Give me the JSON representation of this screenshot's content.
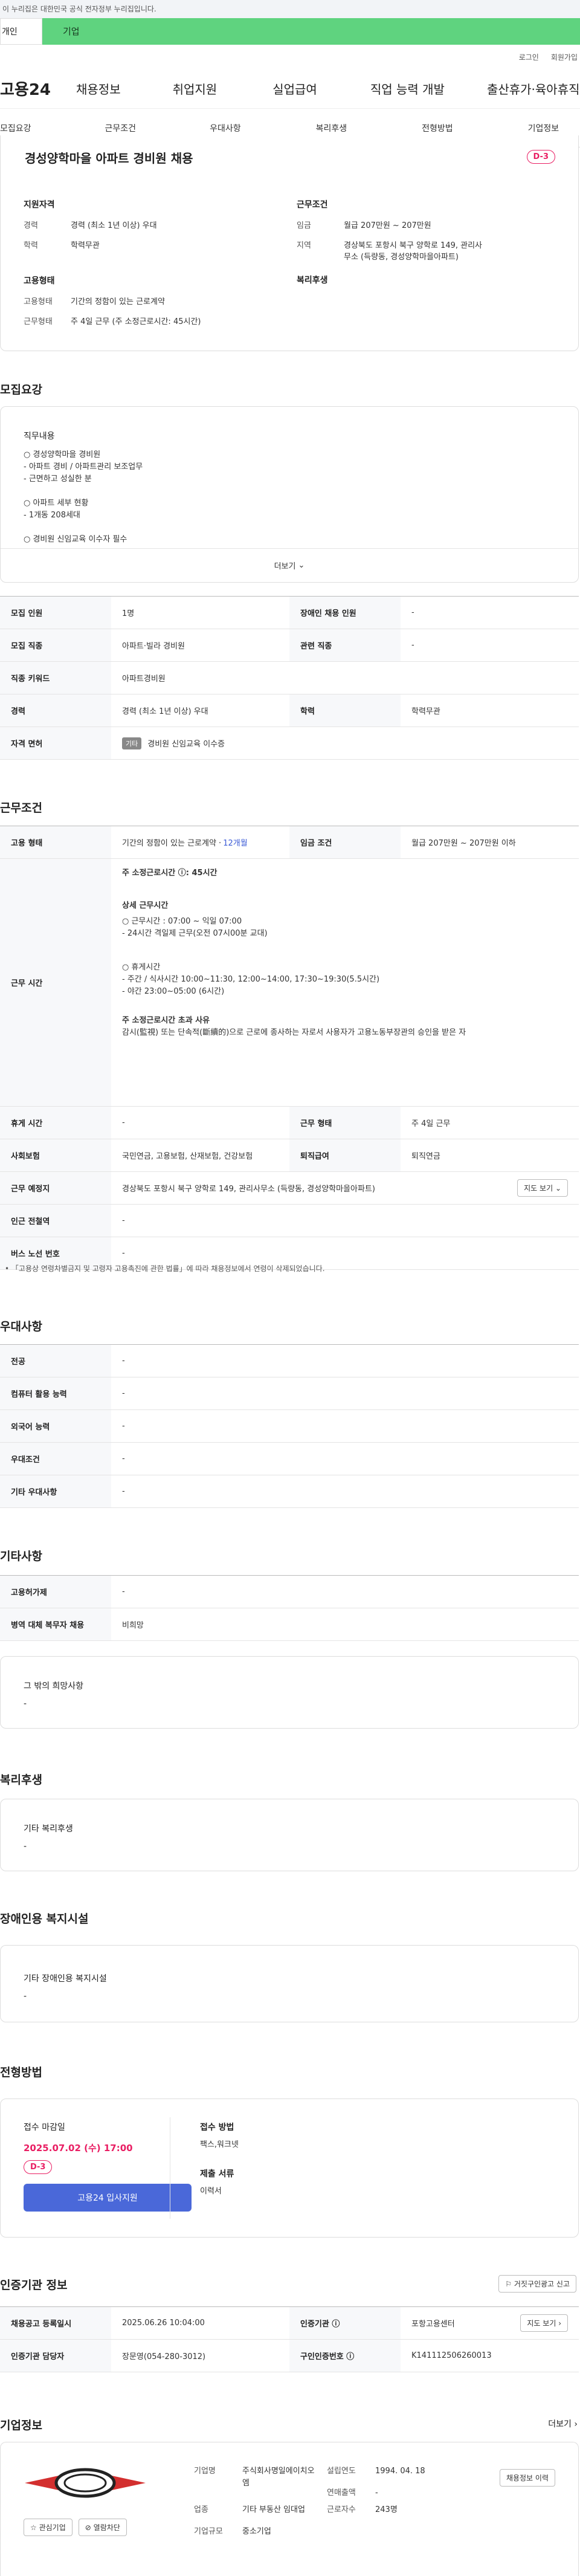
{
  "gov_banner": "이 누리집은 대한민국 공식 전자정부 누리집입니다.",
  "top_tabs": {
    "left": "개인",
    "right": "기업"
  },
  "util": {
    "login": "로그인",
    "join": "회원가입"
  },
  "gnb": {
    "logo": "고용24",
    "menus": [
      "채용정보",
      "취업지원",
      "실업급여",
      "직업 능력 개발",
      "출산휴가·육아휴직"
    ]
  },
  "subnav": [
    "모집요강",
    "근무조건",
    "우대사항",
    "복리후생",
    "전형방법",
    "기업정보"
  ],
  "summary": {
    "title": "경성양학마을 아파트 경비원 채용",
    "dday": "D-3",
    "qual_title": "지원자격",
    "career_k": "경력",
    "career_v": "경력 (최소 1년 이상) 우대",
    "edu_k": "학력",
    "edu_v": "학력무관",
    "cond_title": "근무조건",
    "wage_k": "임금",
    "wage_v": "월급 207만원 ~ 207만원",
    "region_k": "지역",
    "region_v": "경상북도 포항시 북구 양학로 149, 관리사무소 (득량동, 경성양학마을아파트)",
    "emp_title": "고용형태",
    "emptype_k": "고용형태",
    "emptype_v": "기간의 정함이 있는 근로계약",
    "worktype_k": "근무형태",
    "worktype_v": "주 4일 근무 (주 소정근로시간: 45시간)",
    "welfare_title": "복리후생"
  },
  "recruit": {
    "section": "모집요강",
    "duty_title": "직무내용",
    "duty_lines": [
      "○ 경성양학마을 경비원",
      "- 아파트 경비 / 아파트관리 보조업무",
      "- 근면하고 성실한 분",
      "○ 아파트 세부 현황",
      "- 1개동 208세대",
      "○ 경비원 신임교육 이수자 필수"
    ],
    "more": "더보기",
    "rows": [
      [
        "모집 인원",
        "1명",
        "장애인 채용 인원",
        "-"
      ],
      [
        "모집 직종",
        "아파트·빌라 경비원",
        "관련 직종",
        "-"
      ]
    ],
    "keyword_k": "직종 키워드",
    "keyword_v": "아파트경비원",
    "career_k": "경력",
    "career_v": "경력 (최소 1년 이상) 우대",
    "edu_k": "학력",
    "edu_v": "학력무관",
    "license_k": "자격 면허",
    "license_tag": "기타",
    "license_v": "경비원 신임교육 이수증"
  },
  "conditions": {
    "section": "근무조건",
    "emp_k": "고용 형태",
    "emp_v": "기간의 정함이 있는 근로계약 · ",
    "emp_months": "12개월",
    "wage_k": "임금 조건",
    "wage_v": "월급 207만원 ~ 207만원 이하",
    "time_k": "근무 시간",
    "time_lines": [
      "주 소정근로시간 ⓘ: 45시간",
      "상세 근무시간",
      "○ 근무시간 : 07:00 ~ 익일 07:00",
      "- 24시간 격일제 근무(오전 07시00분 교대)",
      "○ 휴게시간",
      "- 주간 / 식사시간 10:00~11:30, 12:00~14:00, 17:30~19:30(5.5시간)",
      "- 야간 23:00~05:00 (6시간)",
      "주 소정근로시간 초과 사유",
      "감시(監視) 또는 단속적(斷續的)으로 근로에 종사하는 자로서 사용자가 고용노동부장관의 승인을 받은 자"
    ],
    "rest_k": "휴게 시간",
    "rest_v": "-",
    "form_k": "근무 형태",
    "form_v": "주 4일 근무",
    "ins_k": "사회보험",
    "ins_v": "국민연금, 고용보험, 산재보험, 건강보험",
    "ret_k": "퇴직급여",
    "ret_v": "퇴직연금",
    "place_k": "근무 예정지",
    "place_v": "경상북도 포항시 북구 양학로 149, 관리사무소 (득량동, 경성양학마을아파트)",
    "map_btn": "지도 보기",
    "station_k": "인근 전철역",
    "station_v": "-",
    "bus_k": "버스 노선 번호",
    "bus_v": "-",
    "notice": "「고용상 연령차별금지 및 고령자 고용촉진에 관한 법률」에 따라 채용정보에서 연령이 삭제되었습니다."
  },
  "pref": {
    "section": "우대사항",
    "rows": [
      [
        "전공",
        "-"
      ],
      [
        "컴퓨터 활용 능력",
        "-"
      ],
      [
        "외국어 능력",
        "-"
      ],
      [
        "우대조건",
        "-"
      ],
      [
        "기타 우대사항",
        "-"
      ]
    ]
  },
  "etc": {
    "section": "기타사항",
    "rows": [
      [
        "고용허가제",
        "-"
      ],
      [
        "병역 대체 복무자 채용",
        "비희망"
      ]
    ],
    "hope_title": "그 밖의 희망사항",
    "hope_v": "-"
  },
  "welfare": {
    "section": "복리후생",
    "box_title": "기타 복리후생",
    "box_v": "-"
  },
  "disab": {
    "section": "장애인용 복지시설",
    "box_title": "기타 장애인용 복지시설",
    "box_v": "-"
  },
  "process": {
    "section": "전형방법",
    "deadline_k": "접수 마감일",
    "deadline_v": "2025.07.02 (수) 17:00",
    "dday": "D-3",
    "apply_btn": "고용24 입사지원",
    "method_k": "접수 방법",
    "method_v": "팩스,워크넷",
    "docs_k": "제출 서류",
    "docs_v": "이력서"
  },
  "cert": {
    "section": "인증기관 정보",
    "report_btn": "거짓구인광고 신고",
    "reg_k": "채용공고 등록일시",
    "reg_v": "2025.06.26 10:04:00",
    "org_k": "인증기관 ⓘ",
    "org_v": "포항고용센터",
    "map_btn": "지도 보기",
    "mgr_k": "인증기관 담당자",
    "mgr_v": "장문영(054-280-3012)",
    "num_k": "구인인증번호 ⓘ",
    "num_v": "K141112506260013"
  },
  "company": {
    "section": "기업정보",
    "more": "더보기",
    "industry_k": "기업명",
    "industry_v": "주식회사명일에이치오엠",
    "year_k": "설립연도",
    "year_v": "1994. 04. 18",
    "history_btn": "채용정보 이력",
    "sales_k": "연매출액",
    "sales_v": "-",
    "biz_k": "업종",
    "biz_v": "기타 부동산 임대업",
    "emp_k": "근로자수",
    "emp_v": "243명",
    "size_k": "기업규모",
    "size_v": "중소기업",
    "fav_btn": "관심기업",
    "block_btn": "열람차단"
  },
  "colors": {
    "accent": "#5fd37f",
    "primary_btn": "#4a68d9",
    "dday": "#e91e63",
    "link": "#3b5bd6"
  }
}
